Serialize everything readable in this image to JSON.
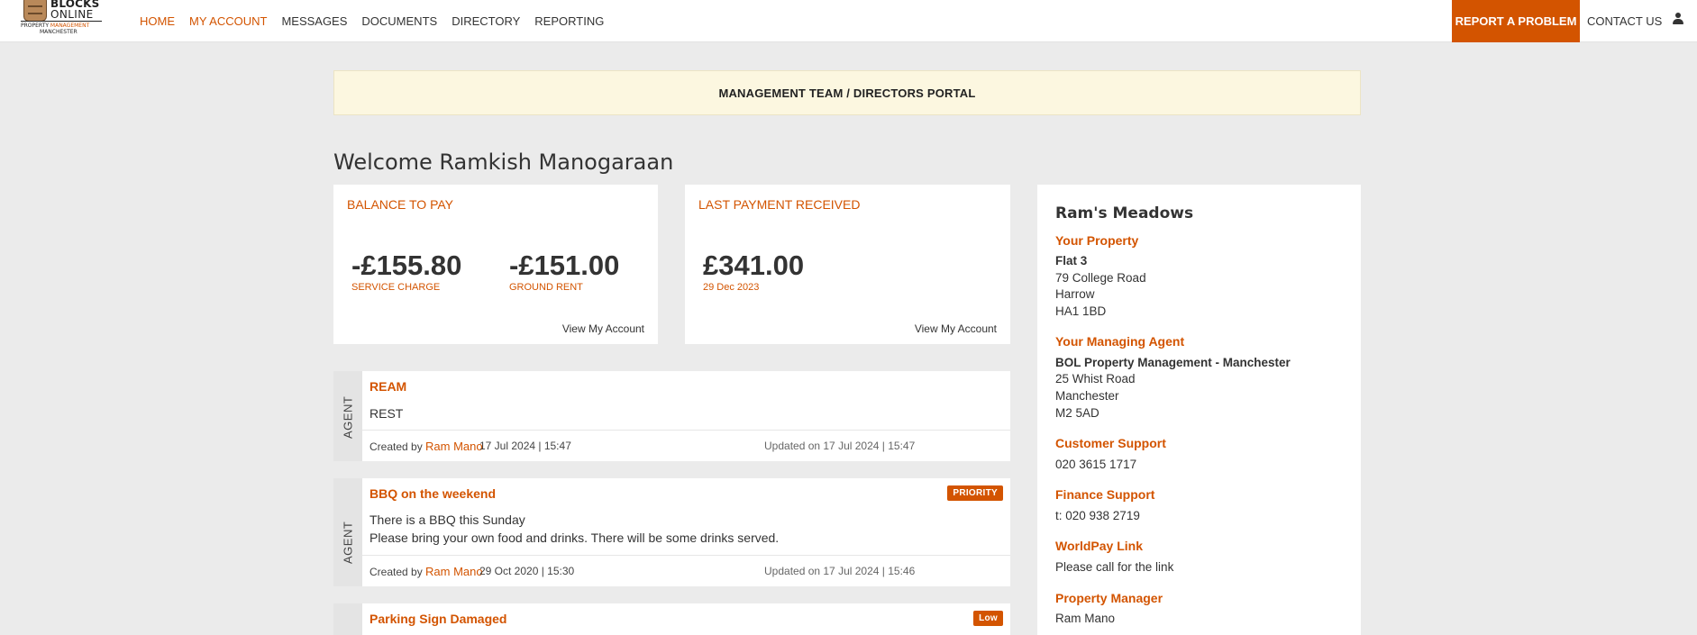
{
  "logo": {
    "line1": "BLOCKS",
    "line2": "ONLINE",
    "line3_a": "PROPERTY",
    "line3_b": "MANAGEMENT",
    "line4": "MANCHESTER"
  },
  "nav": {
    "items": [
      {
        "label": "HOME",
        "active": true
      },
      {
        "label": "MY ACCOUNT",
        "active": true
      },
      {
        "label": "MESSAGES",
        "active": false
      },
      {
        "label": "DOCUMENTS",
        "active": false
      },
      {
        "label": "DIRECTORY",
        "active": false
      },
      {
        "label": "REPORTING",
        "active": false
      }
    ],
    "report_label": "REPORT A PROBLEM",
    "contact_label": "CONTACT US"
  },
  "banner": "MANAGEMENT TEAM / DIRECTORS PORTAL",
  "welcome": "Welcome Ramkish Manogaraan",
  "balance_card": {
    "title": "BALANCE TO PAY",
    "service_amount": "-£155.80",
    "service_label": "SERVICE CHARGE",
    "ground_amount": "-£151.00",
    "ground_label": "GROUND RENT",
    "link": "View My Account"
  },
  "payment_card": {
    "title": "LAST PAYMENT RECEIVED",
    "amount": "£341.00",
    "date": "29 Dec 2023",
    "link": "View My Account"
  },
  "messages": [
    {
      "side": "AGENT",
      "title": "REAM",
      "body": [
        "REST"
      ],
      "created_prefix": "Created by",
      "author": "Ram Mano",
      "created": "17 Jul 2024 | 15:47",
      "updated": "Updated on 17 Jul 2024 | 15:47",
      "badge": ""
    },
    {
      "side": "AGENT",
      "title": "BBQ on the weekend",
      "body": [
        "There is a BBQ this Sunday",
        "Please bring your own food and drinks. There will be some drinks served."
      ],
      "created_prefix": "Created by",
      "author": "Ram Mano",
      "created": "29 Oct 2020 | 15:30",
      "updated": "Updated on 17 Jul 2024 | 15:46",
      "badge": "PRIORITY"
    },
    {
      "side": "",
      "title": "Parking Sign Damaged",
      "body": [],
      "badge": "Low"
    }
  ],
  "panel": {
    "title": "Ram's Meadows",
    "property_heading": "Your Property",
    "property_lines": [
      "Flat 3",
      "79 College Road",
      "Harrow",
      "HA1 1BD"
    ],
    "agent_heading": "Your Managing Agent",
    "agent_lines": [
      "BOL Property Management - Manchester",
      "25 Whist Road",
      "Manchester",
      "M2 5AD"
    ],
    "support_heading": "Customer Support",
    "support_phone": "020 3615 1717",
    "finance_heading": "Finance Support",
    "finance_phone": "t: 020 938 2719",
    "worldpay_heading": "WorldPay Link",
    "worldpay_text": "Please call for the link",
    "manager_heading": "Property Manager",
    "manager_name": "Ram Mano"
  },
  "colors": {
    "accent": "#d35400",
    "banner_bg": "#fcf7e0",
    "page_bg": "#ebebeb"
  }
}
